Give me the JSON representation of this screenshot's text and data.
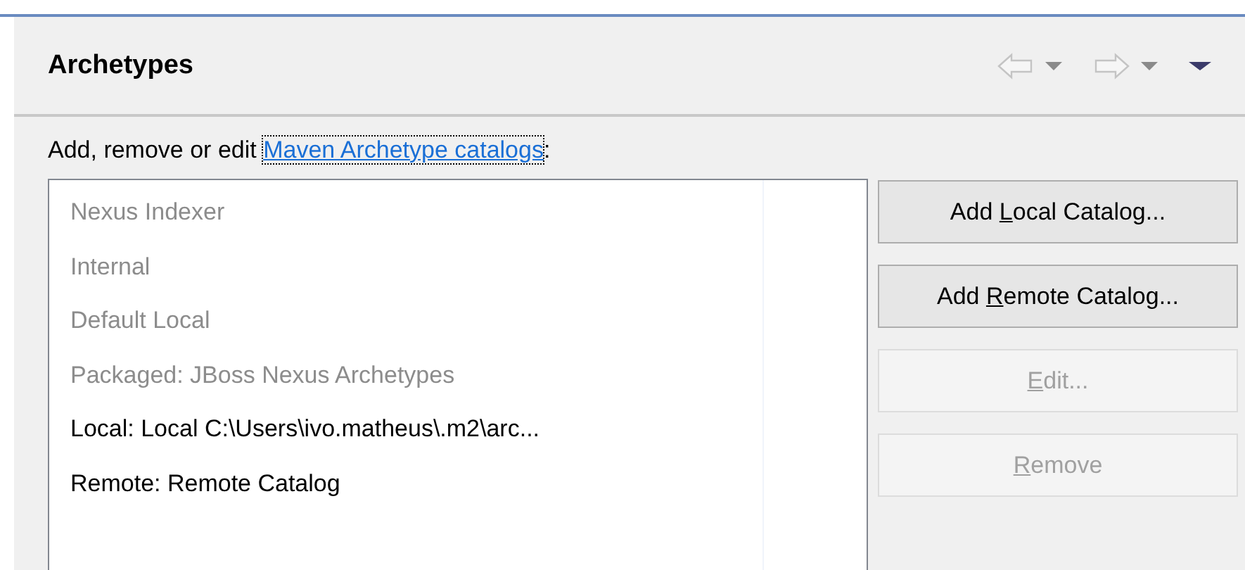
{
  "section": {
    "title": "Archetypes"
  },
  "intro": {
    "text": "Add, remove or edit ",
    "link": "Maven Archetype catalogs",
    "link_focused": true,
    "after": ":"
  },
  "catalogs": [
    {
      "label": "Nexus Indexer",
      "disabled": true
    },
    {
      "label": "Internal",
      "disabled": true
    },
    {
      "label": "Default Local",
      "disabled": true
    },
    {
      "label": "Packaged: JBoss Nexus Archetypes",
      "disabled": true
    },
    {
      "label": "Local: Local C:\\Users\\ivo.matheus\\.m2\\arc...",
      "disabled": false
    },
    {
      "label": "Remote: Remote Catalog",
      "disabled": false
    }
  ],
  "buttons": [
    {
      "before": "Add ",
      "mnemonic": "L",
      "after": "ocal Catalog...",
      "disabled": false
    },
    {
      "before": "Add ",
      "mnemonic": "R",
      "after": "emote Catalog...",
      "disabled": false
    },
    {
      "mnemonic": "E",
      "after": "dit...",
      "disabled": true
    },
    {
      "mnemonic": "R",
      "after": "emove",
      "disabled": true
    }
  ]
}
